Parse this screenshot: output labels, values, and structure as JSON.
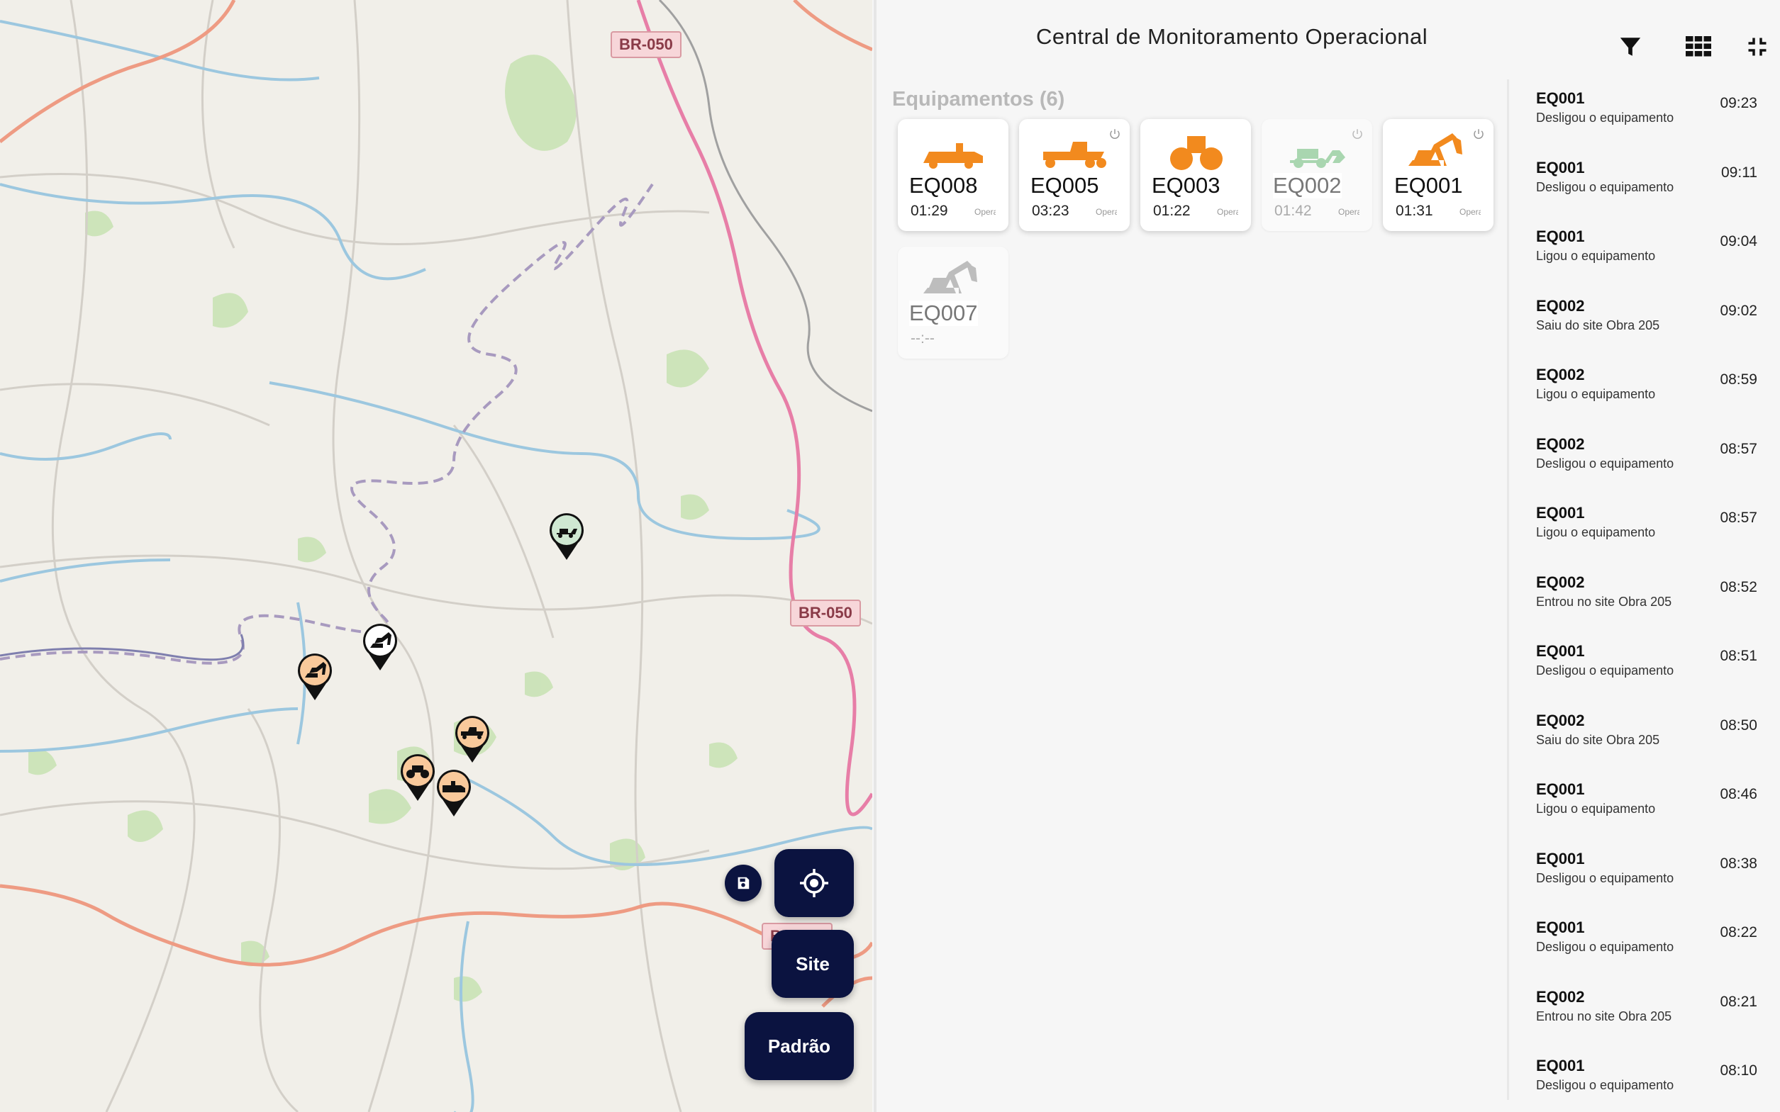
{
  "map": {
    "road_labels": [
      "BR-050",
      "BR-050",
      "BR-050"
    ],
    "fabs": {
      "locate_icon": "crosshair-icon",
      "save_icon": "save-icon",
      "site_label": "Site",
      "default_label": "Padrão"
    }
  },
  "header": {
    "title": "Central de Monitoramento Operacional",
    "icons": [
      "filter-icon",
      "grid-view-icon",
      "collapse-icon"
    ]
  },
  "equipment": {
    "heading": "Equipamentos (6)",
    "cards": [
      {
        "code": "EQ008",
        "time": "01:29",
        "status": "Operando",
        "machine": "paver",
        "color": "#f28a1e",
        "active": true,
        "power": false
      },
      {
        "code": "EQ005",
        "time": "03:23",
        "status": "Operando",
        "machine": "grader",
        "color": "#f28a1e",
        "active": true,
        "power": true
      },
      {
        "code": "EQ003",
        "time": "01:22",
        "status": "Operando",
        "machine": "roller",
        "color": "#f28a1e",
        "active": true,
        "power": false
      },
      {
        "code": "EQ002",
        "time": "01:42",
        "status": "Operando",
        "machine": "loader",
        "color": "#a9d6b0",
        "active": false,
        "power": true
      },
      {
        "code": "EQ001",
        "time": "01:31",
        "status": "Operando",
        "machine": "excavator",
        "color": "#f28a1e",
        "active": true,
        "power": true
      },
      {
        "code": "EQ007",
        "time": "--:--",
        "status": "",
        "machine": "excavator",
        "color": "#bdbdbd",
        "active": false,
        "power": false
      }
    ]
  },
  "events": [
    {
      "code": "EQ001",
      "desc": "Desligou o equipamento",
      "time": "09:23"
    },
    {
      "code": "EQ001",
      "desc": "Desligou o equipamento",
      "time": "09:11"
    },
    {
      "code": "EQ001",
      "desc": "Ligou o equipamento",
      "time": "09:04"
    },
    {
      "code": "EQ002",
      "desc": "Saiu do site Obra 205",
      "time": "09:02"
    },
    {
      "code": "EQ002",
      "desc": "Ligou o equipamento",
      "time": "08:59"
    },
    {
      "code": "EQ002",
      "desc": "Desligou o equipamento",
      "time": "08:57"
    },
    {
      "code": "EQ001",
      "desc": "Ligou o equipamento",
      "time": "08:57"
    },
    {
      "code": "EQ002",
      "desc": "Entrou no site Obra 205",
      "time": "08:52"
    },
    {
      "code": "EQ001",
      "desc": "Desligou o equipamento",
      "time": "08:51"
    },
    {
      "code": "EQ002",
      "desc": "Saiu do site Obra 205",
      "time": "08:50"
    },
    {
      "code": "EQ001",
      "desc": "Ligou o equipamento",
      "time": "08:46"
    },
    {
      "code": "EQ001",
      "desc": "Desligou o equipamento",
      "time": "08:38"
    },
    {
      "code": "EQ001",
      "desc": "Desligou o equipamento",
      "time": "08:22"
    },
    {
      "code": "EQ002",
      "desc": "Entrou no site Obra 205",
      "time": "08:21"
    },
    {
      "code": "EQ001",
      "desc": "Desligou o equipamento",
      "time": "08:10"
    }
  ],
  "map_markers": [
    {
      "machine": "loader",
      "fill": "#cfe8d2"
    },
    {
      "machine": "excavator",
      "fill": "#ffffff"
    },
    {
      "machine": "excavator",
      "fill": "#f9c99b"
    },
    {
      "machine": "grader",
      "fill": "#f9c99b"
    },
    {
      "machine": "roller",
      "fill": "#f9c99b"
    },
    {
      "machine": "paver",
      "fill": "#f9c99b"
    }
  ]
}
